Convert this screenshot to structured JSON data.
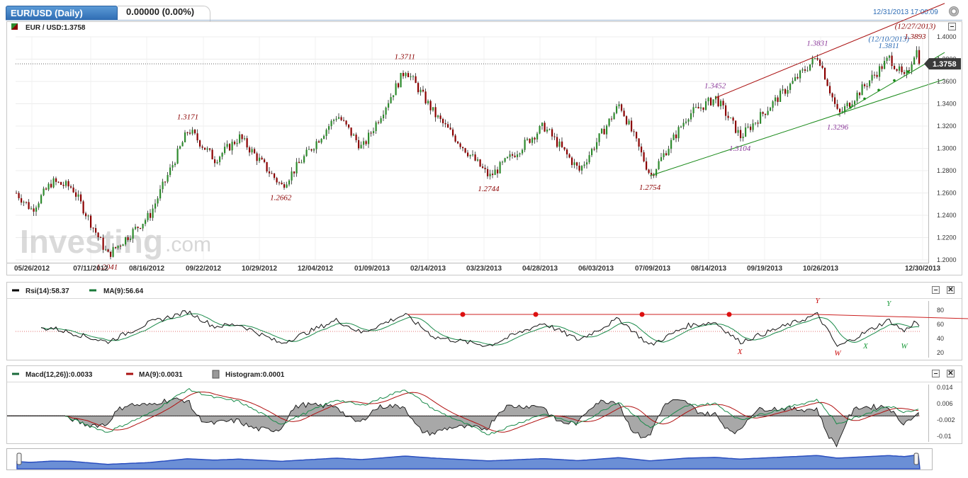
{
  "header": {
    "tab_title": "EUR/USD (Daily)",
    "change": "0.00000 (0.00%)",
    "timestamp": "12/31/2013 17:00:09"
  },
  "main_legend": "EUR / USD:1.3758",
  "rsi_legend": {
    "rsi": "Rsi(14):58.37",
    "ma": "MA(9):56.64"
  },
  "macd_legend": {
    "macd": "Macd(12,26)):0.0033",
    "ma": "MA(9):0.0031",
    "hist": "Histogram:0.0001"
  },
  "watermark": {
    "text": "Investing",
    "suffix": ".com"
  },
  "colors": {
    "up": "#2e8b2e",
    "down": "#8b0000",
    "accent": "#2d6cb5",
    "trend_red": "#aa1010",
    "trend_green": "#1a8a1a",
    "label_red": "#8b0000",
    "label_purple": "#8b3a9a"
  },
  "chart_data": [
    {
      "type": "candlestick",
      "price_badge": "1.3758",
      "ylim": [
        1.2,
        1.4
      ],
      "yticks": [
        "1.4000",
        "1.3800",
        "1.3600",
        "1.3400",
        "1.3200",
        "1.3000",
        "1.2800",
        "1.2600",
        "1.2400",
        "1.2200",
        "1.2000"
      ],
      "ytick_values": [
        1.4,
        1.38,
        1.36,
        1.34,
        1.32,
        1.3,
        1.28,
        1.26,
        1.24,
        1.22,
        1.2
      ],
      "xticks": [
        "05/26/2012",
        "07/11/2012",
        "08/16/2012",
        "09/22/2012",
        "10/29/2012",
        "12/04/2012",
        "01/09/2013",
        "02/14/2013",
        "03/23/2013",
        "04/28/2013",
        "06/03/2013",
        "07/09/2013",
        "08/14/2013",
        "09/19/2013",
        "10/26/2013",
        "12/30/2013"
      ],
      "keypoints": [
        {
          "d": "2012-05-26",
          "v": 1.26
        },
        {
          "d": "2012-06-05",
          "v": 1.245
        },
        {
          "d": "2012-06-18",
          "v": 1.27
        },
        {
          "d": "2012-07-01",
          "v": 1.265
        },
        {
          "d": "2012-07-24",
          "v": 1.2041
        },
        {
          "d": "2012-08-20",
          "v": 1.24
        },
        {
          "d": "2012-09-14",
          "v": 1.3171
        },
        {
          "d": "2012-10-01",
          "v": 1.29
        },
        {
          "d": "2012-10-17",
          "v": 1.31
        },
        {
          "d": "2012-11-13",
          "v": 1.2662
        },
        {
          "d": "2012-12-19",
          "v": 1.33
        },
        {
          "d": "2013-01-04",
          "v": 1.3
        },
        {
          "d": "2013-02-01",
          "v": 1.3711
        },
        {
          "d": "2013-02-20",
          "v": 1.33
        },
        {
          "d": "2013-03-27",
          "v": 1.2744
        },
        {
          "d": "2013-05-01",
          "v": 1.32
        },
        {
          "d": "2013-05-24",
          "v": 1.28
        },
        {
          "d": "2013-06-19",
          "v": 1.34
        },
        {
          "d": "2013-07-09",
          "v": 1.2754
        },
        {
          "d": "2013-08-02",
          "v": 1.33
        },
        {
          "d": "2013-08-20",
          "v": 1.3452
        },
        {
          "d": "2013-09-05",
          "v": 1.3104
        },
        {
          "d": "2013-10-25",
          "v": 1.3831
        },
        {
          "d": "2013-11-07",
          "v": 1.3296
        },
        {
          "d": "2013-12-10",
          "v": 1.3811
        },
        {
          "d": "2013-12-20",
          "v": 1.362
        },
        {
          "d": "2013-12-27",
          "v": 1.3893
        },
        {
          "d": "2013-12-30",
          "v": 1.3758
        }
      ],
      "annotations": [
        {
          "text": "1.2041",
          "d": "2012-07-24",
          "v": 1.2041,
          "pos": "below",
          "color": "red"
        },
        {
          "text": "1.3171",
          "d": "2012-09-14",
          "v": 1.3171,
          "pos": "above",
          "color": "red"
        },
        {
          "text": "1.2662",
          "d": "2012-11-13",
          "v": 1.2662,
          "pos": "below",
          "color": "red"
        },
        {
          "text": "1.3711",
          "d": "2013-02-01",
          "v": 1.3711,
          "pos": "above",
          "color": "red"
        },
        {
          "text": "1.2744",
          "d": "2013-03-27",
          "v": 1.2744,
          "pos": "below",
          "color": "red"
        },
        {
          "text": "1.2754",
          "d": "2013-07-09",
          "v": 1.2754,
          "pos": "below",
          "color": "red"
        },
        {
          "text": "1.3452",
          "d": "2013-08-20",
          "v": 1.3452,
          "pos": "above",
          "color": "purple"
        },
        {
          "text": "1.3104",
          "d": "2013-09-05",
          "v": 1.3104,
          "pos": "below",
          "color": "purple"
        },
        {
          "text": "1.3831",
          "d": "2013-10-25",
          "v": 1.3831,
          "pos": "above",
          "color": "purple"
        },
        {
          "text": "1.3296",
          "d": "2013-11-07",
          "v": 1.3296,
          "pos": "below",
          "color": "purple"
        },
        {
          "text": "(12/10/2013)",
          "d": "2013-12-10",
          "v": 1.387,
          "pos": "above",
          "color": "blue"
        },
        {
          "text": "1.3811",
          "d": "2013-12-10",
          "v": 1.3811,
          "pos": "above",
          "color": "blue"
        },
        {
          "text": "(12/27/2013)",
          "d": "2013-12-27",
          "v": 1.3985,
          "pos": "above",
          "color": "red"
        },
        {
          "text": "1.3893",
          "d": "2013-12-27",
          "v": 1.3893,
          "pos": "above",
          "color": "red"
        }
      ],
      "trendlines": [
        {
          "color": "red",
          "from": {
            "d": "2013-08-20",
            "v": 1.3452
          },
          "to": {
            "d": "2014-01-15",
            "v": 1.43
          }
        },
        {
          "color": "green",
          "from": {
            "d": "2013-07-09",
            "v": 1.2754
          },
          "to": {
            "d": "2014-01-15",
            "v": 1.362
          }
        },
        {
          "color": "green",
          "from": {
            "d": "2013-11-07",
            "v": 1.3296
          },
          "to": {
            "d": "2014-01-15",
            "v": 1.386
          }
        }
      ]
    },
    {
      "type": "line",
      "name": "rsi",
      "ylim": [
        15,
        95
      ],
      "yticks": [
        "80",
        "60",
        "40",
        "20"
      ],
      "ytick_values": [
        80,
        60,
        40,
        20
      ],
      "keypoints": [
        {
          "d": "2012-06-05",
          "v": 52
        },
        {
          "d": "2012-06-18",
          "v": 55
        },
        {
          "d": "2012-07-01",
          "v": 48
        },
        {
          "d": "2012-07-24",
          "v": 35
        },
        {
          "d": "2012-08-20",
          "v": 62
        },
        {
          "d": "2012-09-14",
          "v": 78
        },
        {
          "d": "2012-10-01",
          "v": 57
        },
        {
          "d": "2012-10-17",
          "v": 60
        },
        {
          "d": "2012-11-13",
          "v": 33
        },
        {
          "d": "2012-12-19",
          "v": 66
        },
        {
          "d": "2013-01-04",
          "v": 48
        },
        {
          "d": "2013-02-01",
          "v": 74
        },
        {
          "d": "2013-02-20",
          "v": 42
        },
        {
          "d": "2013-03-27",
          "v": 30
        },
        {
          "d": "2013-05-01",
          "v": 62
        },
        {
          "d": "2013-05-24",
          "v": 38
        },
        {
          "d": "2013-06-19",
          "v": 68
        },
        {
          "d": "2013-07-09",
          "v": 30
        },
        {
          "d": "2013-08-02",
          "v": 58
        },
        {
          "d": "2013-08-20",
          "v": 63
        },
        {
          "d": "2013-09-05",
          "v": 35
        },
        {
          "d": "2013-10-25",
          "v": 74
        },
        {
          "d": "2013-11-07",
          "v": 28
        },
        {
          "d": "2013-12-10",
          "v": 66
        },
        {
          "d": "2013-12-20",
          "v": 50
        },
        {
          "d": "2013-12-27",
          "v": 64
        },
        {
          "d": "2013-12-30",
          "v": 58
        }
      ],
      "labels": [
        {
          "text": "Y",
          "d": "2013-10-25",
          "v": 90,
          "color": "red"
        },
        {
          "text": "X",
          "d": "2013-09-05",
          "v": 18,
          "color": "red"
        },
        {
          "text": "W",
          "d": "2013-11-07",
          "v": 16,
          "color": "red"
        },
        {
          "text": "Y",
          "d": "2013-12-10",
          "v": 86,
          "color": "green"
        },
        {
          "text": "X",
          "d": "2013-11-25",
          "v": 26,
          "color": "green"
        },
        {
          "text": "W",
          "d": "2013-12-20",
          "v": 26,
          "color": "green"
        }
      ]
    },
    {
      "type": "line",
      "name": "macd",
      "ylim": [
        -0.012,
        0.016
      ],
      "yticks": [
        "0.014",
        "0.006",
        "-0.002",
        "-0.01"
      ],
      "ytick_values": [
        0.014,
        0.006,
        -0.002,
        -0.01
      ],
      "keypoints": [
        {
          "d": "2012-06-18",
          "v": 0.002
        },
        {
          "d": "2012-07-10",
          "v": -0.004
        },
        {
          "d": "2012-07-24",
          "v": -0.008
        },
        {
          "d": "2012-08-20",
          "v": 0.001
        },
        {
          "d": "2012-09-14",
          "v": 0.013
        },
        {
          "d": "2012-10-01",
          "v": 0.009
        },
        {
          "d": "2012-10-17",
          "v": 0.007
        },
        {
          "d": "2012-11-13",
          "v": -0.004
        },
        {
          "d": "2012-12-19",
          "v": 0.008
        },
        {
          "d": "2013-01-04",
          "v": 0.005
        },
        {
          "d": "2013-02-01",
          "v": 0.013
        },
        {
          "d": "2013-02-20",
          "v": 0.003
        },
        {
          "d": "2013-03-27",
          "v": -0.009
        },
        {
          "d": "2013-05-01",
          "v": 0.001
        },
        {
          "d": "2013-05-24",
          "v": -0.004
        },
        {
          "d": "2013-06-19",
          "v": 0.007
        },
        {
          "d": "2013-07-09",
          "v": -0.006
        },
        {
          "d": "2013-08-02",
          "v": 0.005
        },
        {
          "d": "2013-08-20",
          "v": 0.006
        },
        {
          "d": "2013-09-05",
          "v": -0.002
        },
        {
          "d": "2013-10-25",
          "v": 0.008
        },
        {
          "d": "2013-11-07",
          "v": -0.004
        },
        {
          "d": "2013-12-10",
          "v": 0.005
        },
        {
          "d": "2013-12-20",
          "v": 0.002
        },
        {
          "d": "2013-12-30",
          "v": 0.003
        }
      ]
    }
  ]
}
